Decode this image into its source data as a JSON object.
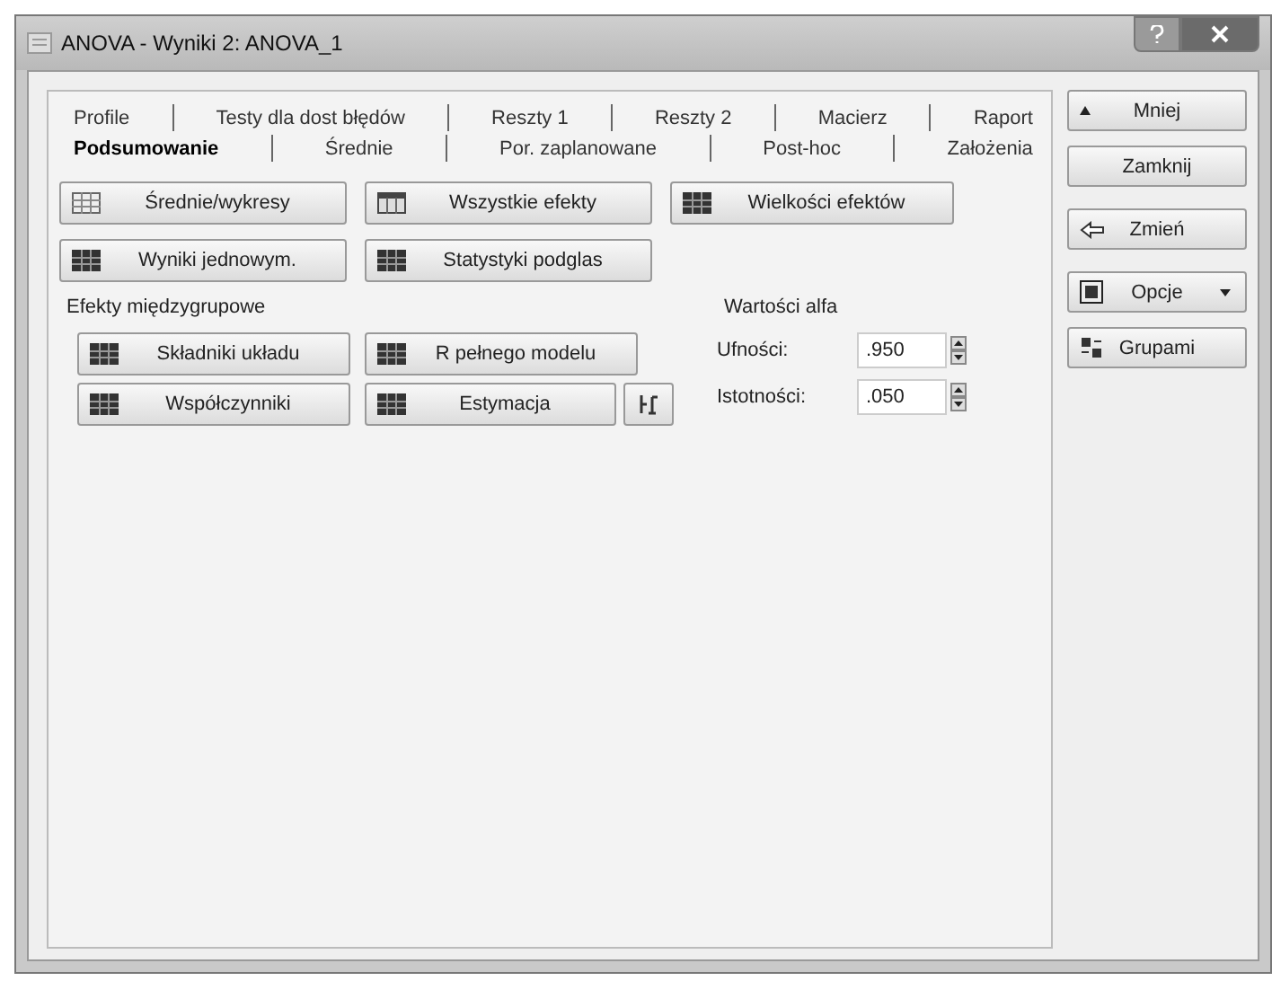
{
  "window": {
    "title": "ANOVA - Wyniki 2: ANOVA_1"
  },
  "tab_rows": [
    [
      {
        "label": "Profile",
        "selected": false
      },
      {
        "label": "Testy dla dost błędów",
        "selected": false
      },
      {
        "label": "Reszty 1",
        "selected": false
      },
      {
        "label": "Reszty 2",
        "selected": false
      },
      {
        "label": "Macierz",
        "selected": false
      },
      {
        "label": "Raport",
        "selected": false
      }
    ],
    [
      {
        "label": "Podsumowanie",
        "selected": true
      },
      {
        "label": "Średnie",
        "selected": false
      },
      {
        "label": "Por. zaplanowane",
        "selected": false
      },
      {
        "label": "Post-hoc",
        "selected": false
      },
      {
        "label": "Założenia",
        "selected": false
      }
    ]
  ],
  "top_buttons": [
    [
      {
        "label": "Średnie/wykresy",
        "kind": "grid"
      },
      {
        "label": "Wszystkie efekty",
        "kind": "table"
      },
      {
        "label": "Wielkości efektów",
        "kind": "dark"
      }
    ],
    [
      {
        "label": "Wyniki jednowym.",
        "kind": "dark"
      },
      {
        "label": "Statystyki podglas",
        "kind": "dark"
      }
    ]
  ],
  "between_effects": {
    "title": "Efekty międzygrupowe",
    "buttons": [
      [
        {
          "label": "Składniki układu"
        },
        {
          "label": "R pełnego modelu"
        }
      ],
      [
        {
          "label": "Współczynniki"
        },
        {
          "label": "Estymacja"
        }
      ]
    ]
  },
  "alpha": {
    "title": "Wartości alfa",
    "fields": [
      {
        "label": "Ufności:",
        "value": ".950"
      },
      {
        "label": "Istotności:",
        "value": ".050"
      }
    ]
  },
  "side_buttons": [
    {
      "label": "Mniej",
      "kind": "up"
    },
    {
      "label": "Zamknij",
      "kind": "plain"
    },
    {
      "label": "Zmień",
      "kind": "back"
    },
    {
      "label": "Opcje",
      "kind": "options",
      "dropdown": true
    },
    {
      "label": "Grupami",
      "kind": "groups"
    }
  ]
}
